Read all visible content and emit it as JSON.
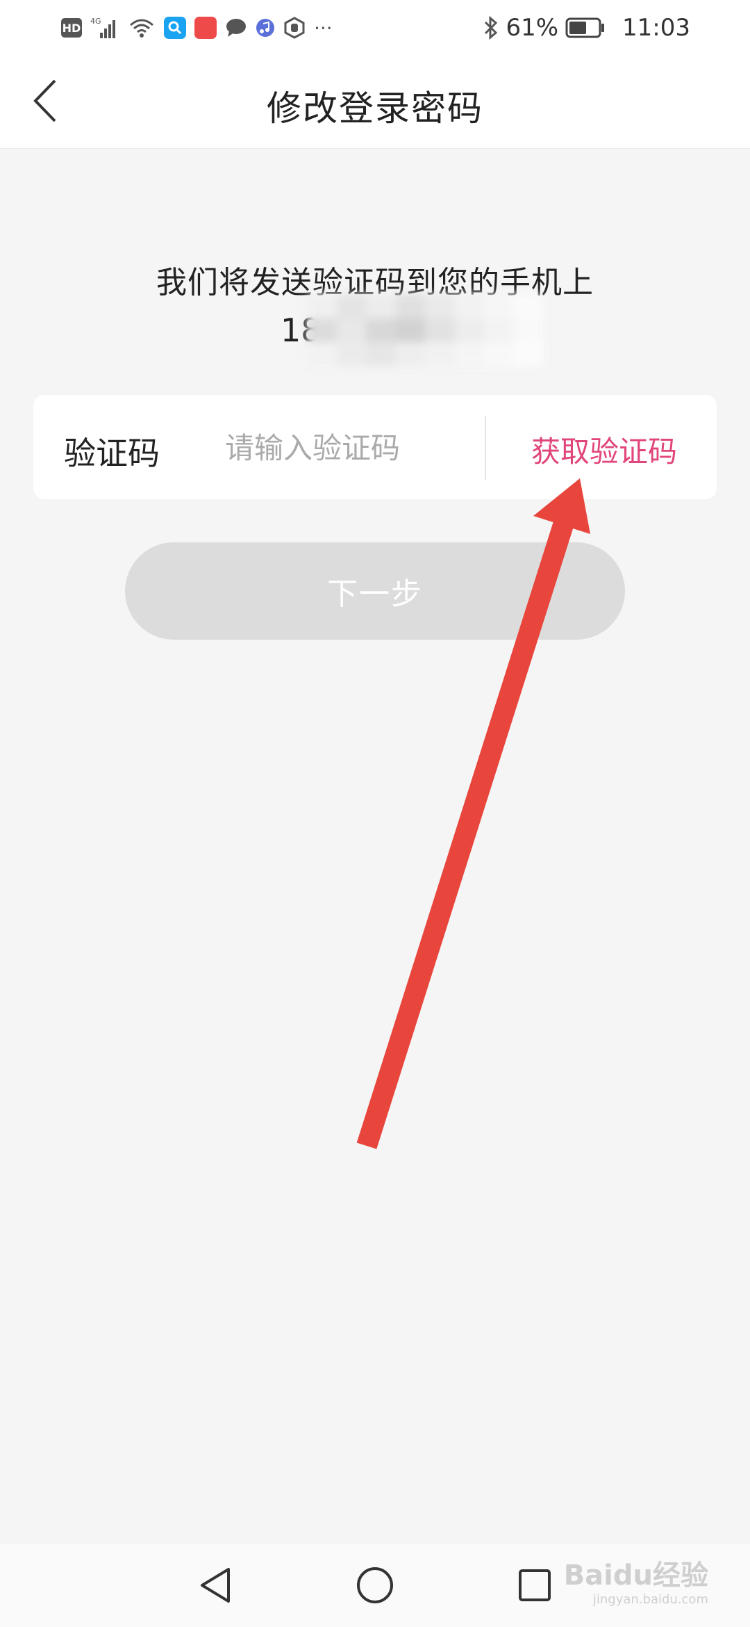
{
  "status_bar": {
    "left_icons": [
      "hd-icon",
      "4g-signal-icon",
      "wifi-icon",
      "search-app-icon",
      "huawei-app-icon",
      "message-icon",
      "music-icon",
      "hand-icon",
      "more-icon"
    ],
    "network_label": "4G",
    "hd_label": "HD",
    "more_label": "···",
    "battery_percent": "61%",
    "battery_level": 0.61,
    "time": "11:03"
  },
  "header": {
    "title": "修改登录密码",
    "back_icon": "chevron-left-icon"
  },
  "main": {
    "send_hint": "我们将发送验证码到您的手机上",
    "phone_prefix": "18",
    "code_label": "验证码",
    "code_placeholder": "请输入验证码",
    "code_value": "",
    "get_code_label": "获取验证码",
    "next_label": "下一步"
  },
  "colors": {
    "accent": "#e0457b",
    "arrow": "#e8453c",
    "disabled_button": "#dcdcdc"
  },
  "nav_bar": {
    "icons": [
      "back-triangle-icon",
      "home-circle-icon",
      "recents-square-icon"
    ]
  },
  "watermark": {
    "brand": "Baidu经验",
    "url": "jingyan.baidu.com"
  }
}
